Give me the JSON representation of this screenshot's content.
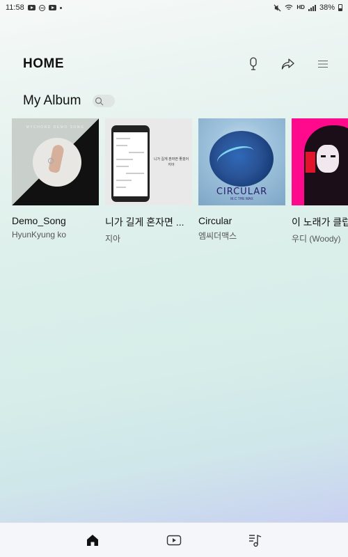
{
  "status_bar": {
    "time": "11:58",
    "hd_label": "HD",
    "battery": "38%"
  },
  "header": {
    "title": "HOME",
    "icons": [
      "microphone-icon",
      "share-icon",
      "menu-icon"
    ]
  },
  "section": {
    "title": "My Album",
    "search_icon": "search-icon"
  },
  "albums": [
    {
      "title": "Demo_Song",
      "artist": "HyunKyung ko",
      "cover_top": "MYCHORD DEMO SONG"
    },
    {
      "title": "니가 길게 혼자면 ...",
      "artist": "지아",
      "cover_text": "니가 길게 혼자면 좋겠어 지아"
    },
    {
      "title": "Circular",
      "artist": "엠씨더맥스",
      "cover_title": "CIRCULAR",
      "cover_sub": "M.C THE MAX"
    },
    {
      "title": "이 노래가 클럽에서",
      "artist": "우디 (Woody)"
    }
  ],
  "bottom_nav": {
    "items": [
      "home-icon",
      "video-icon",
      "music-list-icon"
    ],
    "active": "home"
  },
  "colors": {
    "accent": "#111111",
    "nav_bg": "#f4f6f9"
  }
}
